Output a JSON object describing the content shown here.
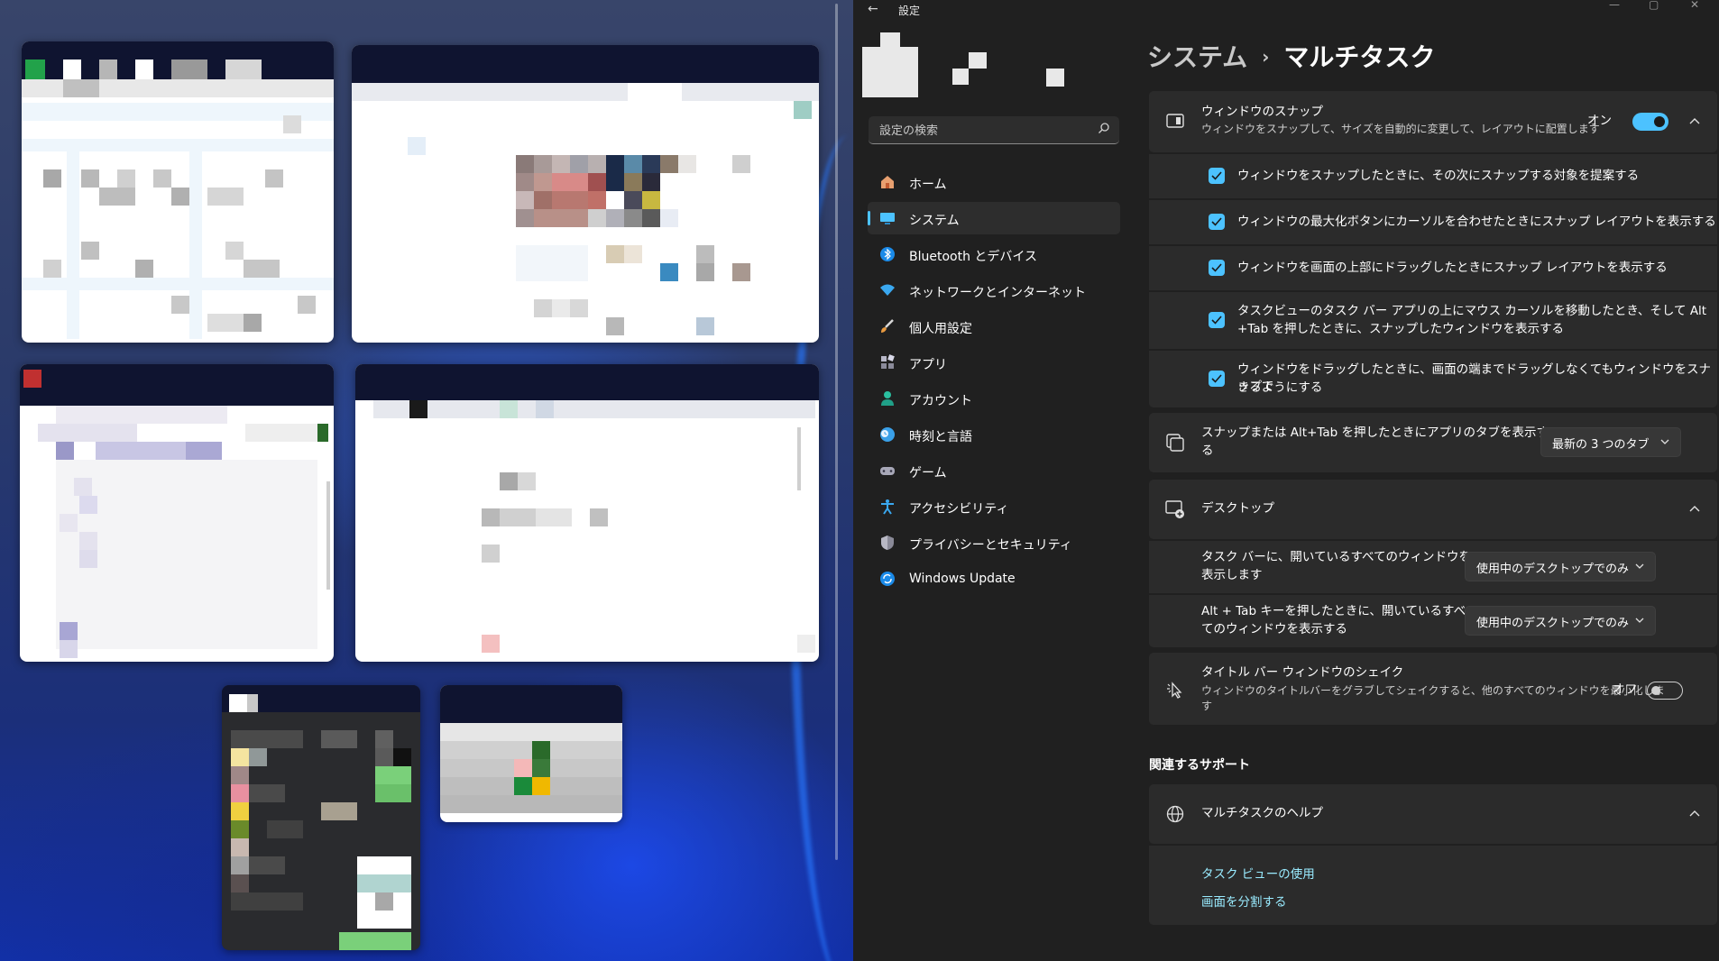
{
  "app": {
    "title": "設定"
  },
  "search": {
    "placeholder": "設定の検索"
  },
  "nav": [
    {
      "label": "ホーム",
      "icon": "home-icon"
    },
    {
      "label": "システム",
      "icon": "monitor-icon",
      "active": true
    },
    {
      "label": "Bluetooth とデバイス",
      "icon": "bluetooth-icon"
    },
    {
      "label": "ネットワークとインターネット",
      "icon": "wifi-icon"
    },
    {
      "label": "個人用設定",
      "icon": "brush-icon"
    },
    {
      "label": "アプリ",
      "icon": "apps-icon"
    },
    {
      "label": "アカウント",
      "icon": "person-icon"
    },
    {
      "label": "時刻と言語",
      "icon": "clock-globe-icon"
    },
    {
      "label": "ゲーム",
      "icon": "gamepad-icon"
    },
    {
      "label": "アクセシビリティ",
      "icon": "accessibility-icon"
    },
    {
      "label": "プライバシーとセキュリティ",
      "icon": "shield-icon"
    },
    {
      "label": "Windows Update",
      "icon": "update-icon"
    }
  ],
  "breadcrumb": {
    "parent": "システム",
    "separator": "›",
    "current": "マルチタスク"
  },
  "snap": {
    "title": "ウィンドウのスナップ",
    "description": "ウィンドウをスナップして、サイズを自動的に変更して、レイアウトに配置します",
    "state_label": "オン",
    "toggle_on": true,
    "options": [
      {
        "line1": "ウィンドウをスナップしたときに、その次にスナップする対象を提案する",
        "line2": "",
        "checked": true
      },
      {
        "line1": "ウィンドウの最大化ボタンにカーソルを合わせたときにスナップ レイアウトを表示する",
        "line2": "",
        "checked": true
      },
      {
        "line1": "ウィンドウを画面の上部にドラッグしたときにスナップ レイアウトを表示する",
        "line2": "",
        "checked": true
      },
      {
        "line1": "タスクビューのタスク バー アプリの上にマウス カーソルを移動したとき、そして Alt",
        "line2": "+Tab を押したときに、スナップしたウィンドウを表示する",
        "checked": true
      },
      {
        "line1": "ウィンドウをドラッグしたときに、画面の端までドラッグしなくてもウィンドウをスナップで",
        "line2": "きるようにする",
        "checked": true
      }
    ]
  },
  "alttab_tabs": {
    "line1": "スナップまたは Alt+Tab を押したときにアプリのタブを表示す",
    "line2": "る",
    "value": "最新の 3 つのタブ"
  },
  "desktops": {
    "title": "デスクトップ",
    "taskbar": {
      "line1": "タスク バーに、開いているすべてのウィンドウを",
      "line2": "表示します",
      "value": "使用中のデスクトップでのみ"
    },
    "alttab": {
      "line1": "Alt + Tab キーを押したときに、開いているすべ",
      "line2": "てのウィンドウを表示する",
      "value": "使用中のデスクトップでのみ"
    }
  },
  "shake": {
    "title": "タイトル バー ウィンドウのシェイク",
    "desc_line1": "ウィンドウのタイトルバーをグラブしてシェイクすると、他のすべてのウィンドウを最小化しま",
    "desc_line2": "す",
    "state_label": "オフ",
    "toggle_on": false
  },
  "related": {
    "heading": "関連するサポート",
    "help_title": "マルチタスクのヘルプ",
    "links": [
      "タスク ビューの使用",
      "画面を分割する"
    ]
  },
  "colors": {
    "accent": "#4cc2ff",
    "panel": "#2b2b2b",
    "background": "#202020"
  }
}
